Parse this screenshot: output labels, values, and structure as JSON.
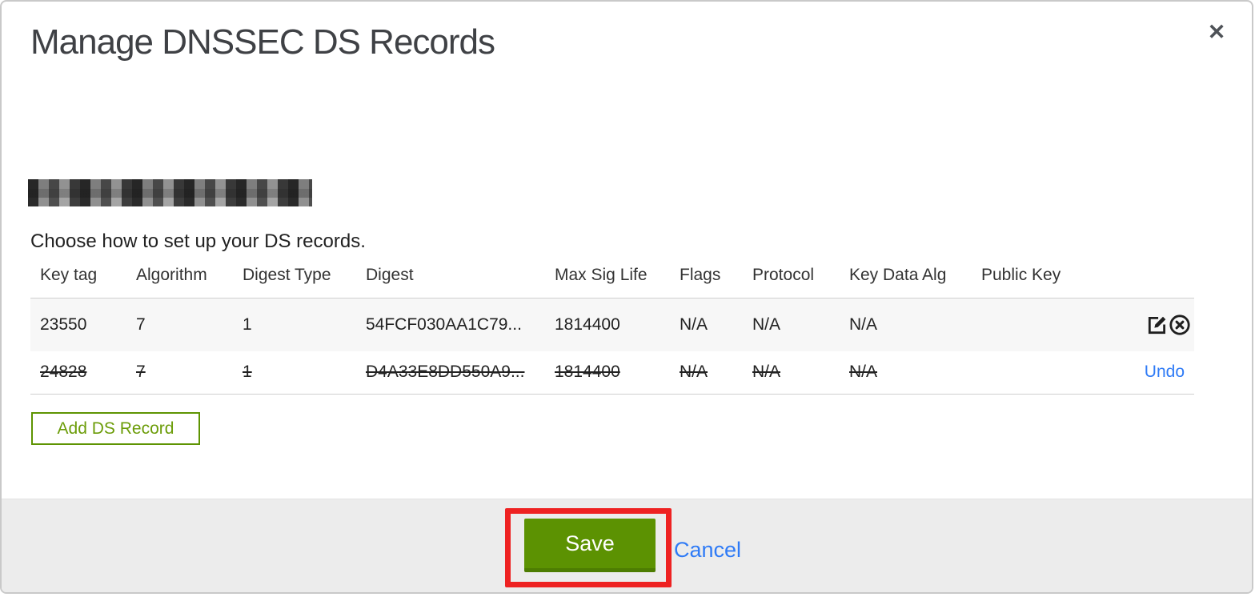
{
  "window": {
    "title": "Manage DNSSEC DS Records",
    "close_icon": "✕"
  },
  "intro": "Choose how to set up your DS records.",
  "table": {
    "headers": [
      "Key tag",
      "Algorithm",
      "Digest Type",
      "Digest",
      "Max Sig Life",
      "Flags",
      "Protocol",
      "Key Data Alg",
      "Public Key"
    ],
    "rows": [
      {
        "cells": [
          "23550",
          "7",
          "1",
          "54FCF030AA1C79...",
          "1814400",
          "N/A",
          "N/A",
          "N/A",
          ""
        ],
        "state": "current",
        "actions": [
          "edit",
          "remove"
        ]
      },
      {
        "cells": [
          "24828",
          "7",
          "1",
          "D4A33E8DD550A9...",
          "1814400",
          "N/A",
          "N/A",
          "N/A",
          ""
        ],
        "state": "deleted",
        "undo_label": "Undo"
      }
    ]
  },
  "buttons": {
    "add": "Add DS Record",
    "save": "Save",
    "cancel": "Cancel"
  },
  "colors": {
    "save_green": "#5c9202",
    "save_green_dark": "#4d7d02",
    "add_border_green": "#5e9402",
    "link_blue": "#2f7bf6",
    "annotation_red": "#ee2222",
    "row_highlight": "#f7f7f7",
    "footer_bg": "#ececec",
    "title_gray": "#3f4145"
  }
}
